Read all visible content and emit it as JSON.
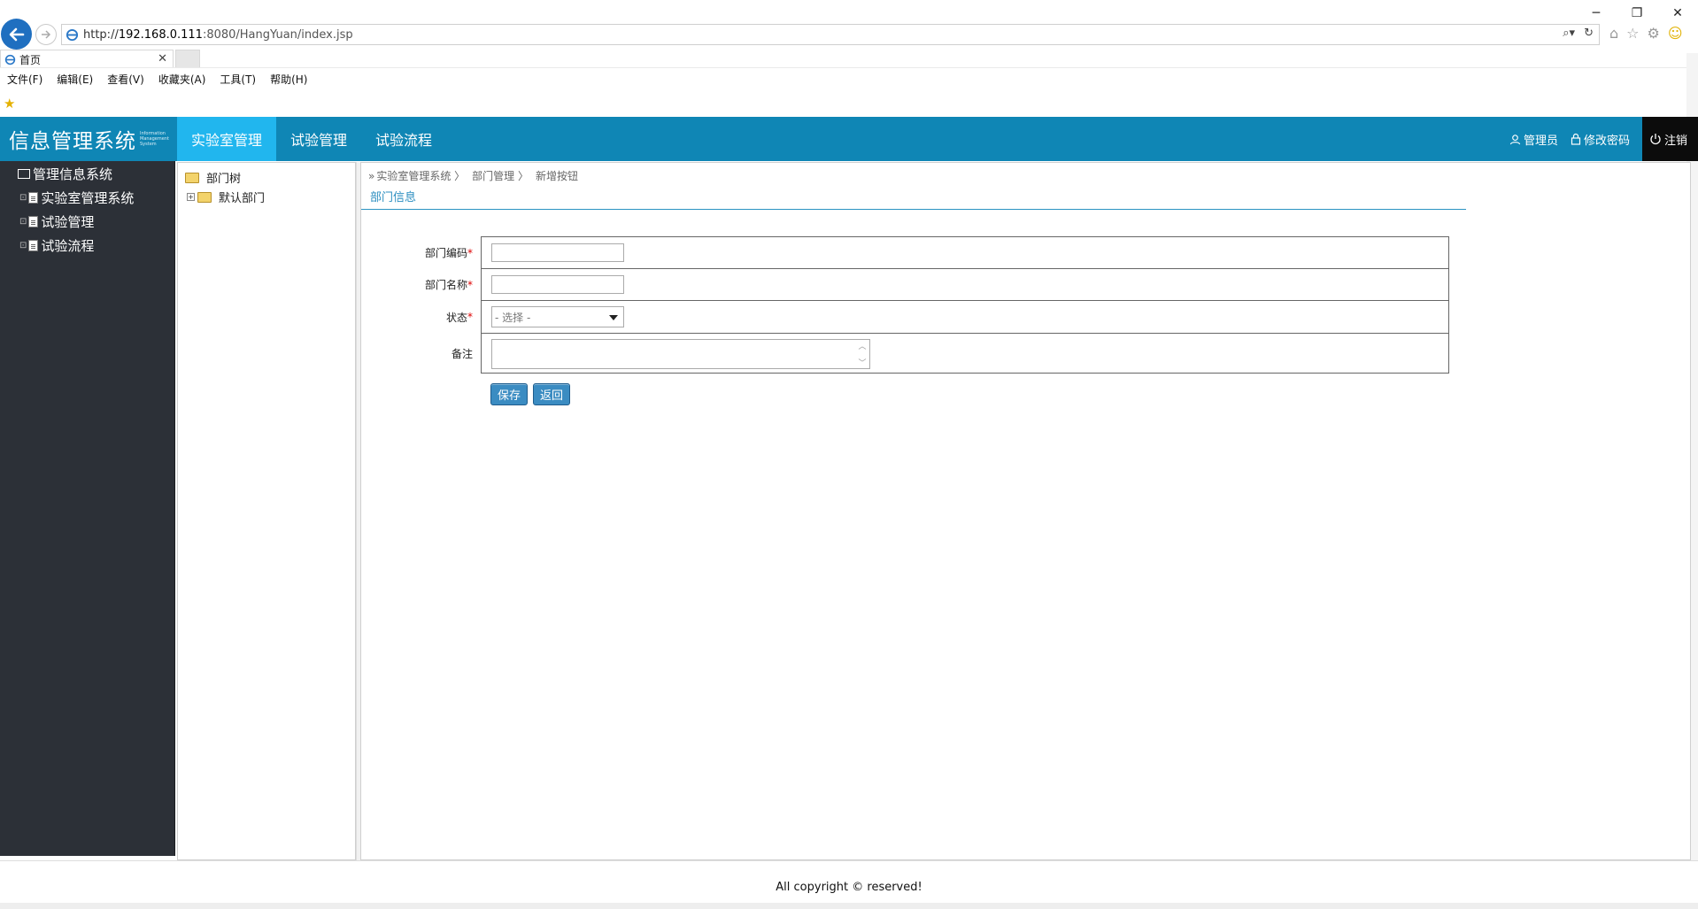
{
  "browser": {
    "url_prefix": "http://",
    "url_host": "192.168.0.111",
    "url_rest": ":8080/HangYuan/index.jsp",
    "tab_title": "首页",
    "tab_close": "✕",
    "window_controls": [
      "─",
      "❐",
      "✕"
    ],
    "menu": [
      "文件(F)",
      "编辑(E)",
      "查看(V)",
      "收藏夹(A)",
      "工具(T)",
      "帮助(H)"
    ]
  },
  "header": {
    "logo_title": "信息管理系统",
    "logo_subtitle": "Information Management System",
    "nav": [
      {
        "label": "实验室管理",
        "active": true
      },
      {
        "label": "试验管理",
        "active": false
      },
      {
        "label": "试验流程",
        "active": false
      }
    ],
    "user_label": "管理员",
    "change_password_label": "修改密码",
    "logout_label": "注销",
    "accent_color": "#0f86b5",
    "active_color": "#21b6ee"
  },
  "left_tree": {
    "root": "管理信息系统",
    "children": [
      "实验室管理系统",
      "试验管理",
      "试验流程"
    ]
  },
  "dept_tree": {
    "root": "部门树",
    "children": [
      "默认部门"
    ]
  },
  "breadcrumb": [
    "实验室管理系统 〉",
    "部门管理 〉",
    "新增按钮"
  ],
  "section_title": "部门信息",
  "form": {
    "fields": [
      {
        "label": "部门编码",
        "required": true,
        "type": "text",
        "value": ""
      },
      {
        "label": "部门名称",
        "required": true,
        "type": "text",
        "value": ""
      },
      {
        "label": "状态",
        "required": true,
        "type": "select",
        "value": "- 选择 -"
      },
      {
        "label": "备注",
        "required": false,
        "type": "textarea",
        "value": ""
      }
    ],
    "required_mark": "*",
    "save_label": "保存",
    "back_label": "返回"
  },
  "footer": {
    "copyright": "All copyright © reserved!"
  }
}
